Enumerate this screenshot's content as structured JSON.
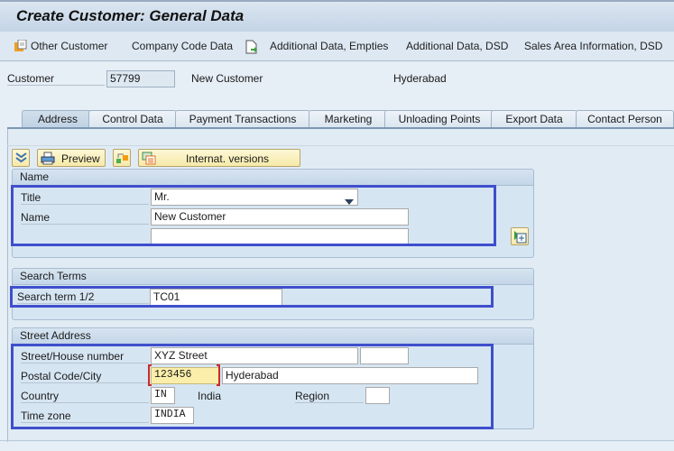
{
  "window": {
    "title": "Create Customer: General Data"
  },
  "appbar": {
    "items": [
      {
        "label": "Other Customer",
        "icon": "other-customer-icon"
      },
      {
        "label": "Company Code Data"
      },
      {
        "label": "Additional Data, Empties",
        "icon": "document-arrow-icon"
      },
      {
        "label": "Additional Data, DSD"
      },
      {
        "label": "Sales Area Information, DSD"
      }
    ]
  },
  "header": {
    "customer_label": "Customer",
    "customer_number": "57799",
    "customer_name": "New Customer",
    "city": "Hyderabad"
  },
  "tabs": [
    {
      "label": "Address",
      "active": true
    },
    {
      "label": "Control Data"
    },
    {
      "label": "Payment Transactions"
    },
    {
      "label": "Marketing"
    },
    {
      "label": "Unloading Points"
    },
    {
      "label": "Export Data"
    },
    {
      "label": "Contact Person"
    }
  ],
  "toolbar": {
    "preview_label": "Preview",
    "internat_label": "Internat. versions"
  },
  "name_group": {
    "title": "Name",
    "title_label": "Title",
    "title_value": "Mr.",
    "name_label": "Name",
    "name_value": "New Customer",
    "name2_value": ""
  },
  "search_group": {
    "title": "Search Terms",
    "label": "Search term 1/2",
    "value1": "TC01",
    "value2": ""
  },
  "street_group": {
    "title": "Street Address",
    "street_label": "Street/House number",
    "street_value": "XYZ Street",
    "house_value": "",
    "postal_label": "Postal Code/City",
    "postal_value": "123456",
    "city_value": "Hyderabad",
    "country_label": "Country",
    "country_code": "IN",
    "country_name": "India",
    "region_label": "Region",
    "region_value": "",
    "timezone_label": "Time zone",
    "timezone_value": "INDIA"
  },
  "colors": {
    "highlight": "#3f4fcc",
    "button_bg": "#f6e9a8"
  }
}
